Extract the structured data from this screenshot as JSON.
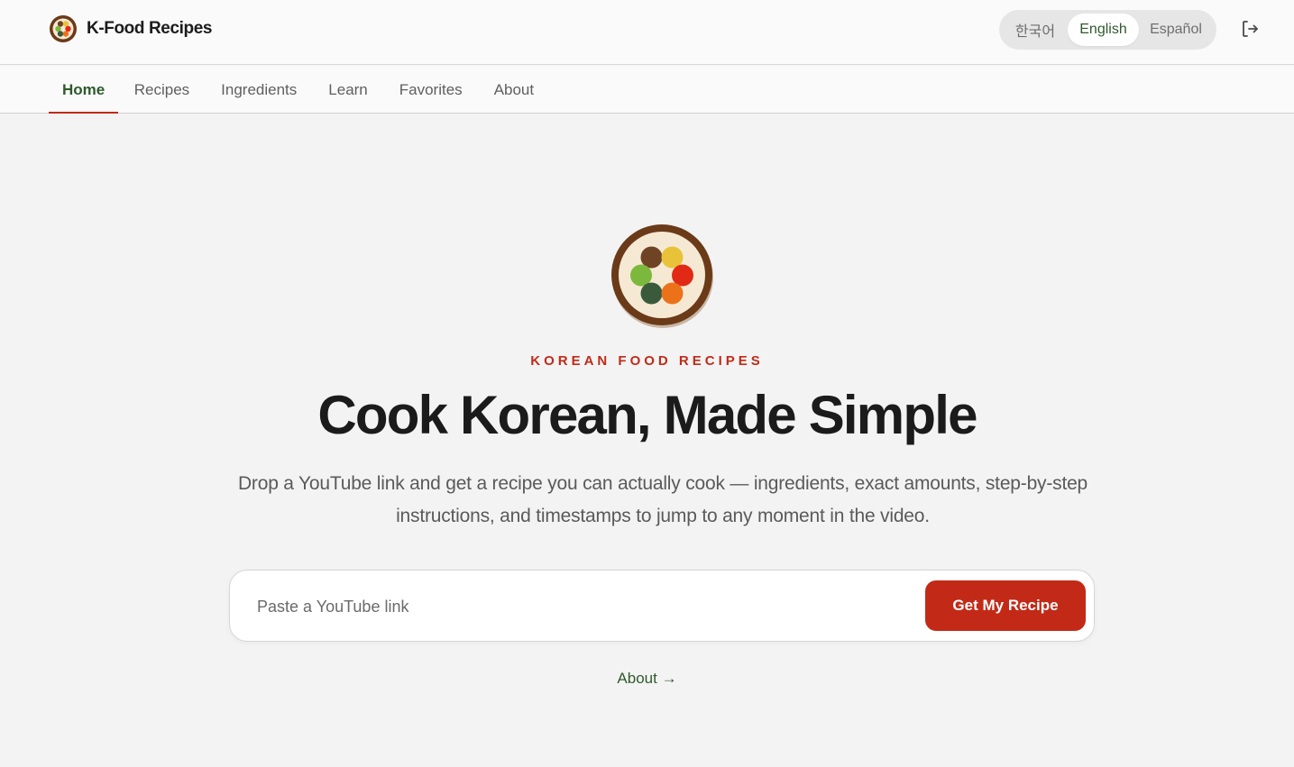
{
  "header": {
    "brand_name": "K-Food Recipes",
    "languages": [
      "한국어",
      "English",
      "Español"
    ],
    "active_language": "English"
  },
  "nav": {
    "tabs": [
      "Home",
      "Recipes",
      "Ingredients",
      "Learn",
      "Favorites",
      "About"
    ],
    "active_tab": "Home"
  },
  "hero": {
    "eyebrow": "KOREAN FOOD RECIPES",
    "headline": "Cook Korean, Made Simple",
    "subtitle": "Drop a YouTube link and get a recipe you can actually cook — ingredients, exact amounts, step-by-step instructions, and timestamps to jump to any moment in the video."
  },
  "search": {
    "placeholder": "Paste a YouTube link",
    "value": "",
    "button_label": "Get My Recipe"
  },
  "footer_link": {
    "label": "About →"
  },
  "colors": {
    "accent_red": "#c22a17",
    "accent_green": "#2e5a2c",
    "logo_rim": "#6b3a18",
    "logo_plate": "#f6e9d4",
    "dot_brown": "#6e4424",
    "dot_yellow": "#e8c33a",
    "dot_green": "#7cb83c",
    "dot_red": "#e12a16",
    "dot_darkgreen": "#3a5a3c",
    "dot_orange": "#ec721a"
  }
}
